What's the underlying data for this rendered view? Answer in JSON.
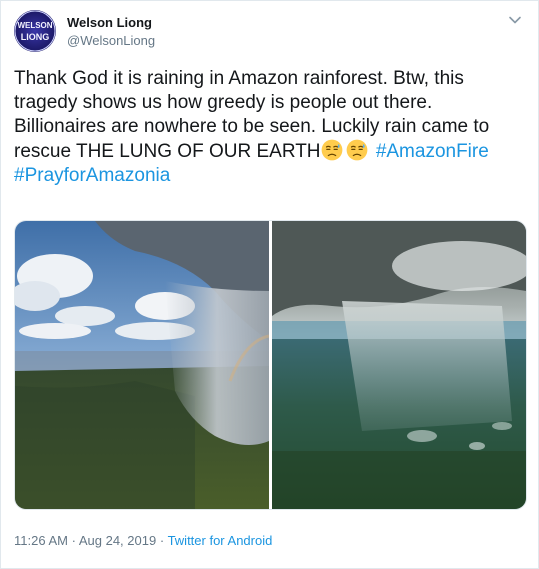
{
  "user": {
    "display_name": "Welson Liong",
    "handle": "@WelsonLiong",
    "avatar_text_top": "WELSON",
    "avatar_text_bottom": "LIONG"
  },
  "tweet": {
    "text_part1": "Thank God it is raining in Amazon rainforest. Btw, this tragedy shows us how greedy is people out there. Billionaires are nowhere to be seen. Luckily rain came to rescue THE LUNG OF OUR EARTH",
    "emoji_1": "downcast-face-with-sweat",
    "emoji_2": "downcast-face-with-sweat",
    "hashtag_1": "#AmazonFire",
    "hashtag_2": "#PrayforAmazonia"
  },
  "footer": {
    "time": "11:26 AM",
    "separator_1": "·",
    "date": "Aug 24, 2019",
    "separator_2": "·",
    "source": "Twitter for Android"
  },
  "colors": {
    "link": "#1b95e0",
    "muted": "#657786",
    "text": "#14171a",
    "border": "#e1e8ed"
  },
  "icons": {
    "menu": "chevron-down-icon"
  }
}
